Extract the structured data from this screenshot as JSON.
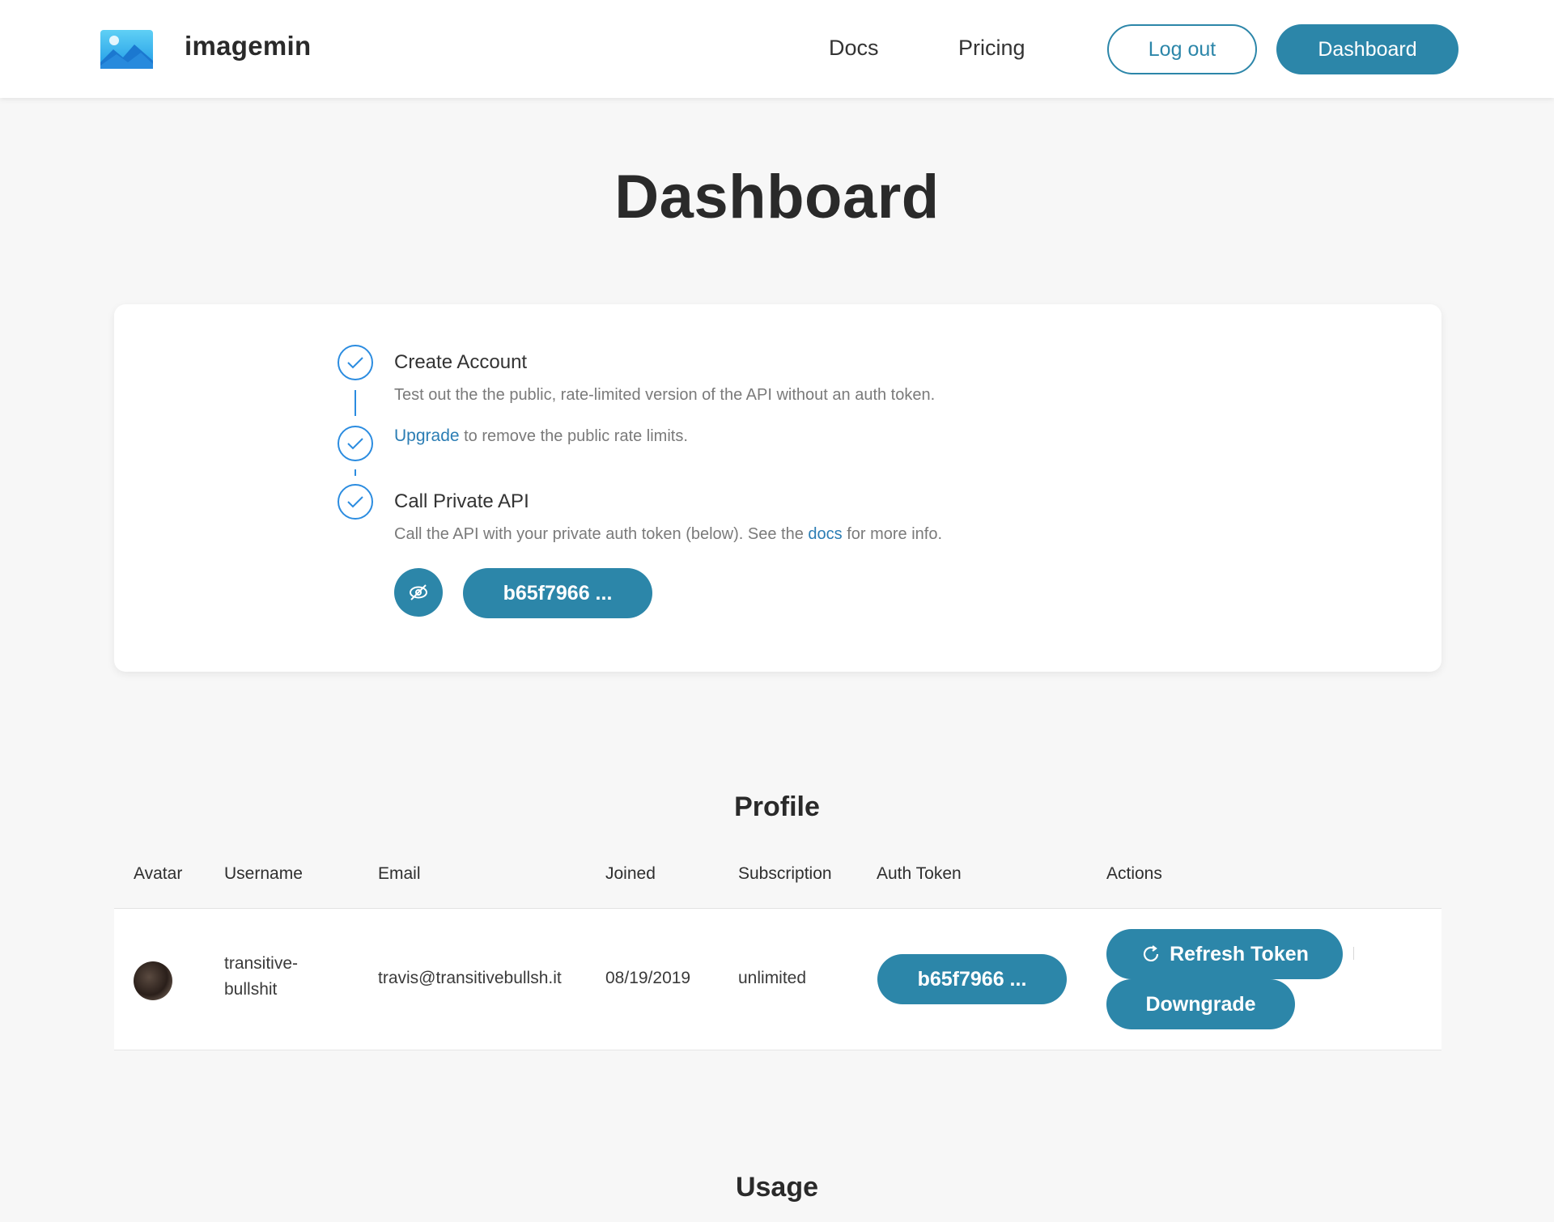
{
  "header": {
    "brand": "imagemin",
    "nav": {
      "docs": "Docs",
      "pricing": "Pricing"
    },
    "logout_label": "Log out",
    "dashboard_label": "Dashboard"
  },
  "page": {
    "title": "Dashboard"
  },
  "steps": {
    "step1": {
      "title": "Create Account",
      "desc": "Test out the the public, rate-limited version of the API without an auth token."
    },
    "step2": {
      "link": "Upgrade",
      "desc": "to remove the public rate limits."
    },
    "step3": {
      "title": "Call Private API",
      "desc_before": "Call the API with your private auth token (below). See the",
      "desc_link": "docs",
      "desc_after": "for more info."
    },
    "token": "b65f7966 ..."
  },
  "profile": {
    "title": "Profile",
    "columns": [
      "Avatar",
      "Username",
      "Email",
      "Joined",
      "Subscription",
      "Auth Token",
      "Actions"
    ],
    "row": {
      "username_line1": "transitive-",
      "username_line2": "bullshit",
      "email": "travis@transitivebullsh.it",
      "joined": "08/19/2019",
      "subscription": "unlimited",
      "token": "b65f7966 ...",
      "refresh_label": "Refresh Token",
      "downgrade_label": "Downgrade"
    }
  },
  "usage": {
    "title": "Usage"
  },
  "colors": {
    "accent": "#2c86a9",
    "step_blue": "#2b8ce0",
    "link": "#2b7db4"
  }
}
